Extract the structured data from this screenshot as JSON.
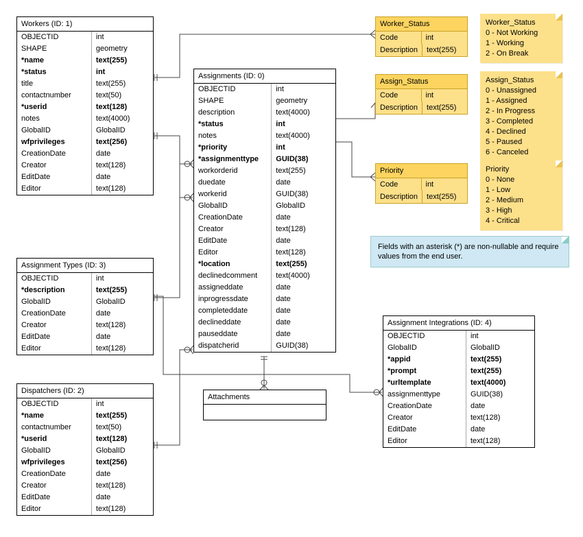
{
  "entities": {
    "workers": {
      "title": "Workers (ID: 1)",
      "fields": [
        {
          "name": "OBJECTID",
          "type": "int",
          "bold": false
        },
        {
          "name": "SHAPE",
          "type": "geometry",
          "bold": false
        },
        {
          "name": "*name",
          "type": "text(255)",
          "bold": true
        },
        {
          "name": "*status",
          "type": "int",
          "bold": true
        },
        {
          "name": "title",
          "type": "text(255)",
          "bold": false
        },
        {
          "name": "contactnumber",
          "type": "text(50)",
          "bold": false
        },
        {
          "name": "*userid",
          "type": "text(128)",
          "bold": true
        },
        {
          "name": "notes",
          "type": "text(4000)",
          "bold": false
        },
        {
          "name": "GlobalID",
          "type": "GlobalID",
          "bold": false
        },
        {
          "name": "wfprivileges",
          "type": "text(256)",
          "bold": true
        },
        {
          "name": "CreationDate",
          "type": "date",
          "bold": false
        },
        {
          "name": "Creator",
          "type": "text(128)",
          "bold": false
        },
        {
          "name": "EditDate",
          "type": "date",
          "bold": false
        },
        {
          "name": "Editor",
          "type": "text(128)",
          "bold": false
        }
      ]
    },
    "assignments": {
      "title": "Assignments (ID: 0)",
      "fields": [
        {
          "name": "OBJECTID",
          "type": "int",
          "bold": false
        },
        {
          "name": "SHAPE",
          "type": "geometry",
          "bold": false
        },
        {
          "name": "description",
          "type": "text(4000)",
          "bold": false
        },
        {
          "name": "*status",
          "type": "int",
          "bold": true
        },
        {
          "name": "notes",
          "type": "text(4000)",
          "bold": false
        },
        {
          "name": "*priority",
          "type": "int",
          "bold": true
        },
        {
          "name": "*assignmenttype",
          "type": "GUID(38)",
          "bold": true
        },
        {
          "name": "workorderid",
          "type": "text(255)",
          "bold": false
        },
        {
          "name": "duedate",
          "type": "date",
          "bold": false
        },
        {
          "name": "workerid",
          "type": "GUID(38)",
          "bold": false
        },
        {
          "name": "GlobalID",
          "type": "GlobalID",
          "bold": false
        },
        {
          "name": "CreationDate",
          "type": "date",
          "bold": false
        },
        {
          "name": "Creator",
          "type": "text(128)",
          "bold": false
        },
        {
          "name": "EditDate",
          "type": "date",
          "bold": false
        },
        {
          "name": "Editor",
          "type": "text(128)",
          "bold": false
        },
        {
          "name": "*location",
          "type": "text(255)",
          "bold": true
        },
        {
          "name": "declinedcomment",
          "type": "text(4000)",
          "bold": false
        },
        {
          "name": "assigneddate",
          "type": "date",
          "bold": false
        },
        {
          "name": "inprogressdate",
          "type": "date",
          "bold": false
        },
        {
          "name": "completeddate",
          "type": "date",
          "bold": false
        },
        {
          "name": "declineddate",
          "type": "date",
          "bold": false
        },
        {
          "name": "pauseddate",
          "type": "date",
          "bold": false
        },
        {
          "name": "dispatcherid",
          "type": "GUID(38)",
          "bold": false
        }
      ]
    },
    "assignment_types": {
      "title": "Assignment Types (ID: 3)",
      "fields": [
        {
          "name": "OBJECTID",
          "type": "int",
          "bold": false
        },
        {
          "name": "*description",
          "type": "text(255)",
          "bold": true
        },
        {
          "name": "GlobalID",
          "type": "GlobalID",
          "bold": false
        },
        {
          "name": "CreationDate",
          "type": "date",
          "bold": false
        },
        {
          "name": "Creator",
          "type": "text(128)",
          "bold": false
        },
        {
          "name": "EditDate",
          "type": "date",
          "bold": false
        },
        {
          "name": "Editor",
          "type": "text(128)",
          "bold": false
        }
      ]
    },
    "dispatchers": {
      "title": "Dispatchers (ID: 2)",
      "fields": [
        {
          "name": "OBJECTID",
          "type": "int",
          "bold": false
        },
        {
          "name": "*name",
          "type": "text(255)",
          "bold": true
        },
        {
          "name": "contactnumber",
          "type": "text(50)",
          "bold": false
        },
        {
          "name": "*userid",
          "type": "text(128)",
          "bold": true
        },
        {
          "name": "GlobalID",
          "type": "GlobalID",
          "bold": false
        },
        {
          "name": "wfprivileges",
          "type": "text(256)",
          "bold": true
        },
        {
          "name": "CreationDate",
          "type": "date",
          "bold": false
        },
        {
          "name": "Creator",
          "type": "text(128)",
          "bold": false
        },
        {
          "name": "EditDate",
          "type": "date",
          "bold": false
        },
        {
          "name": "Editor",
          "type": "text(128)",
          "bold": false
        }
      ]
    },
    "assignment_integrations": {
      "title": "Assignment Integrations (ID: 4)",
      "fields": [
        {
          "name": "OBJECTID",
          "type": "int",
          "bold": false
        },
        {
          "name": "GlobalID",
          "type": "GlobalID",
          "bold": false
        },
        {
          "name": "*appid",
          "type": "text(255)",
          "bold": true
        },
        {
          "name": "*prompt",
          "type": "text(255)",
          "bold": true
        },
        {
          "name": "*urltemplate",
          "type": "text(4000)",
          "bold": true
        },
        {
          "name": "assignmenttype",
          "type": "GUID(38)",
          "bold": false
        },
        {
          "name": "CreationDate",
          "type": "date",
          "bold": false
        },
        {
          "name": "Creator",
          "type": "text(128)",
          "bold": false
        },
        {
          "name": "EditDate",
          "type": "date",
          "bold": false
        },
        {
          "name": "Editor",
          "type": "text(128)",
          "bold": false
        }
      ]
    }
  },
  "lookups": {
    "worker_status": {
      "title": "Worker_Status",
      "fields": [
        {
          "name": "Code",
          "type": "int"
        },
        {
          "name": "Description",
          "type": "text(255)"
        }
      ]
    },
    "assign_status": {
      "title": "Assign_Status",
      "fields": [
        {
          "name": "Code",
          "type": "int"
        },
        {
          "name": "Description",
          "type": "text(255)"
        }
      ]
    },
    "priority": {
      "title": "Priority",
      "fields": [
        {
          "name": "Code",
          "type": "int"
        },
        {
          "name": "Description",
          "type": "text(255)"
        }
      ]
    }
  },
  "notes": {
    "worker_status": {
      "title": "Worker_Status",
      "lines": [
        "0 - Not Working",
        "1 - Working",
        "2 - On Break"
      ]
    },
    "assign_status": {
      "title": "Assign_Status",
      "lines": [
        "0 - Unassigned",
        "1 - Assigned",
        "2 - In Progress",
        "3 - Completed",
        "4 - Declined",
        "5 - Paused",
        "6 - Canceled"
      ]
    },
    "priority": {
      "title": "Priority",
      "lines": [
        "0 - None",
        "1 - Low",
        "2 - Medium",
        "3 - High",
        "4 - Critical"
      ]
    }
  },
  "info_note": "Fields with an asterisk (*) are non-nullable and require values from the end user.",
  "attachments": {
    "title": "Attachments"
  }
}
